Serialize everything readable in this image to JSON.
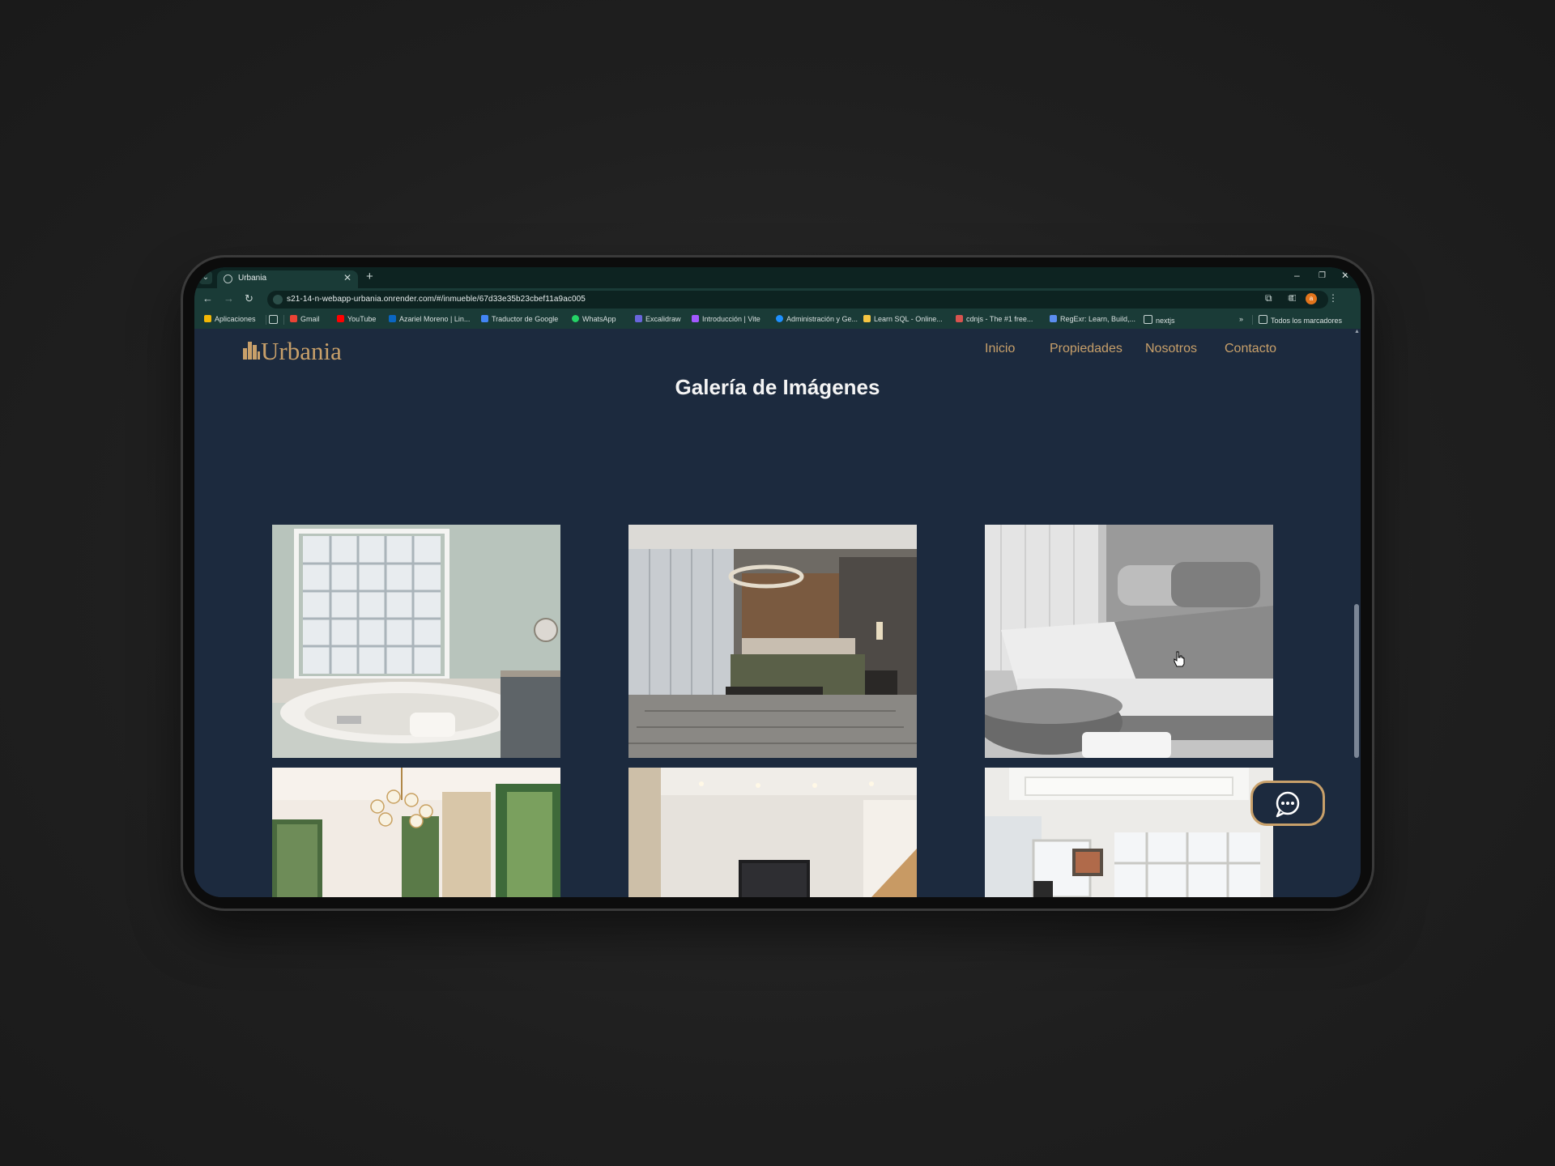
{
  "browser": {
    "tab_title": "Urbania",
    "url": "s21-14-n-webapp-urbania.onrender.com/#/inmueble/67d33e35b23cbef11a9ac005",
    "bookmarks": [
      {
        "label": "Aplicaciones",
        "icon": "apps-grid-icon",
        "color": "#f2b705"
      },
      {
        "label": "Gmail",
        "icon": "gmail-icon",
        "color": "#ea4335"
      },
      {
        "label": "YouTube",
        "icon": "youtube-icon",
        "color": "#ff0000"
      },
      {
        "label": "Azariel Moreno | Lin...",
        "icon": "linkedin-icon",
        "color": "#0a66c2"
      },
      {
        "label": "Traductor de Google",
        "icon": "google-translate-icon",
        "color": "#4285f4"
      },
      {
        "label": "WhatsApp",
        "icon": "whatsapp-icon",
        "color": "#25d366"
      },
      {
        "label": "Excalidraw",
        "icon": "excalidraw-icon",
        "color": "#6965db"
      },
      {
        "label": "Introducción | Vite",
        "icon": "vite-icon",
        "color": "#a259ff"
      },
      {
        "label": "Administración y Ge...",
        "icon": "edge-icon",
        "color": "#1e90ff"
      },
      {
        "label": "Learn SQL - Online...",
        "icon": "sql-icon",
        "color": "#f5c542"
      },
      {
        "label": "cdnjs - The #1 free...",
        "icon": "cdnjs-icon",
        "color": "#d9534f"
      },
      {
        "label": "RegExr: Learn, Build,...",
        "icon": "regexr-icon",
        "color": "#5b8def"
      },
      {
        "label": "nextjs",
        "icon": "folder-icon",
        "color": "#c9d6d4"
      }
    ],
    "all_bookmarks_label": "Todos los marcadores",
    "profile_initial": "a"
  },
  "site": {
    "brand": "Urbania",
    "nav": [
      "Inicio",
      "Propiedades",
      "Nosotros",
      "Contacto"
    ],
    "accent_color": "#c8a06a",
    "background_color": "#1c2a3e"
  },
  "gallery": {
    "title": "Galería de Imágenes",
    "images": [
      {
        "name": "bathroom-jacuzzi-photo"
      },
      {
        "name": "bedroom-wood-wall-photo"
      },
      {
        "name": "bed-gray-photo"
      },
      {
        "name": "living-room-chandelier-photo"
      },
      {
        "name": "room-tv-photo"
      },
      {
        "name": "white-living-room-photo"
      }
    ]
  },
  "chat": {
    "icon": "chat-bubble-icon"
  }
}
